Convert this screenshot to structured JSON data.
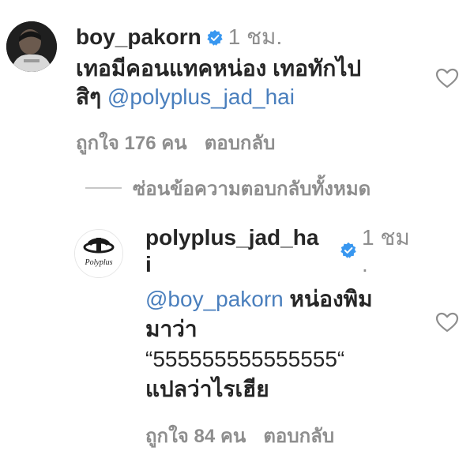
{
  "comment": {
    "username": "boy_pakorn",
    "time": "1 ชม.",
    "text_line1": "เทอมีคอนแทคหน่อง เทอทักไป",
    "text_line2_prefix": "สิๆ",
    "mention": "@polyplus_jad_hai",
    "likes": "ถูกใจ 176 คน",
    "reply_label": "ตอบกลับ"
  },
  "hide_replies": "ซ่อนข้อความตอบกลับทั้งหมด",
  "reply": {
    "username_line1": "polyplus_jad_ha",
    "username_line2": "i",
    "time_line1": "1 ชม",
    "time_line2": ".",
    "mention": "@boy_pakorn",
    "text_after_mention": "หน่องพิม",
    "text_line2": "มาว่า",
    "text_line3": "“555555555555555“",
    "text_line4": "แปลว่าไรเฮีย",
    "likes": "ถูกใจ 84 คน",
    "reply_label": "ตอบกลับ",
    "avatar_logo_text": "Polyplus"
  },
  "colors": {
    "text": "#262626",
    "secondary": "#8e8e8e",
    "mention": "#4a7fbd",
    "verified": "#3897f0"
  },
  "icons": {
    "verified": "verified-badge-icon",
    "like": "heart-outline-icon"
  }
}
